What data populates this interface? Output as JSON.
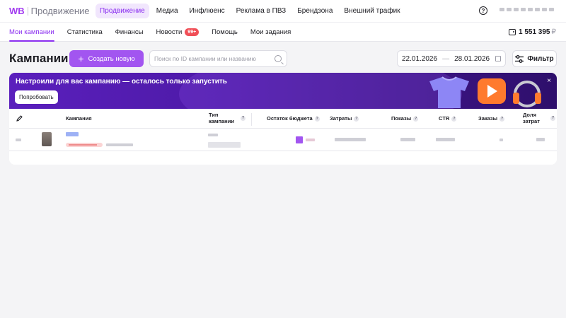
{
  "header": {
    "logo_brand": "WB",
    "logo_sub": "Продвижение",
    "nav": [
      "Продвижение",
      "Медиа",
      "Инфлюенс",
      "Реклама в ПВЗ",
      "Брендзона",
      "Внешний трафик"
    ],
    "help_glyph": "?",
    "icons": {
      "help": "help-icon",
      "account": "account-icon"
    }
  },
  "subnav": {
    "items": [
      "Мои кампании",
      "Статистика",
      "Финансы",
      "Новости",
      "Помощь",
      "Мои задания"
    ],
    "news_badge": "99+",
    "balance": "1 551 395",
    "currency": "₽"
  },
  "toolbar": {
    "title": "Кампании",
    "create_label": "Создать новую",
    "search_placeholder": "Поиск по ID кампании или названию",
    "date_from": "22.01.2026",
    "date_to": "28.01.2026",
    "filter_label": "Фильтр"
  },
  "banner": {
    "title": "Настроили для вас кампанию — осталось только запустить",
    "button": "Попробовать",
    "close": "×"
  },
  "table": {
    "columns": {
      "campaign": "Кампания",
      "type": "Тип кампании",
      "budget": "Остаток бюджета",
      "spend": "Затраты",
      "views": "Показы",
      "ctr": "CTR",
      "orders": "Заказы",
      "share": "Доля затрат"
    },
    "help_glyph": "?"
  },
  "colors": {
    "accent": "#a255f0",
    "accent_text": "#8b2ff0",
    "badge": "#f04f57",
    "banner_start": "#5a1fbd",
    "banner_end": "#2e0f6b"
  }
}
